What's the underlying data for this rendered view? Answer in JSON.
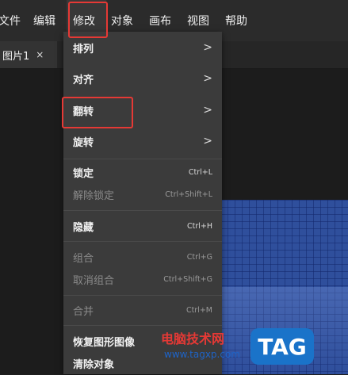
{
  "menubar": {
    "items": [
      {
        "label": "文件"
      },
      {
        "label": "编辑"
      },
      {
        "label": "修改"
      },
      {
        "label": "对象"
      },
      {
        "label": "画布"
      },
      {
        "label": "视图"
      },
      {
        "label": "帮助"
      }
    ]
  },
  "tab": {
    "title": "图片1",
    "close": "×"
  },
  "dropdown": {
    "submenus": [
      {
        "label": "排列",
        "chevron": ">"
      },
      {
        "label": "对齐",
        "chevron": ">"
      },
      {
        "label": "翻转",
        "chevron": ">"
      },
      {
        "label": "旋转",
        "chevron": ">"
      }
    ],
    "items": [
      {
        "label": "锁定",
        "shortcut": "Ctrl+L",
        "enabled": true
      },
      {
        "label": "解除锁定",
        "shortcut": "Ctrl+Shift+L",
        "enabled": false
      },
      {
        "label": "隐藏",
        "shortcut": "Ctrl+H",
        "enabled": true
      },
      {
        "label": "组合",
        "shortcut": "Ctrl+G",
        "enabled": false
      },
      {
        "label": "取消组合",
        "shortcut": "Ctrl+Shift+G",
        "enabled": false
      },
      {
        "label": "合并",
        "shortcut": "Ctrl+M",
        "enabled": false
      },
      {
        "label": "恢复图形图像",
        "shortcut": "",
        "enabled": true
      },
      {
        "label": "清除对象",
        "shortcut": "",
        "enabled": true
      }
    ]
  },
  "watermark": {
    "title": "电脑技术网",
    "url": "www.tagxp.com",
    "badge": "TAG"
  },
  "colors": {
    "highlight": "#e53935",
    "menu_bg": "#3b3b3b",
    "menubar_bg": "#2b2b2b",
    "badge_bg": "#1a73c9"
  }
}
